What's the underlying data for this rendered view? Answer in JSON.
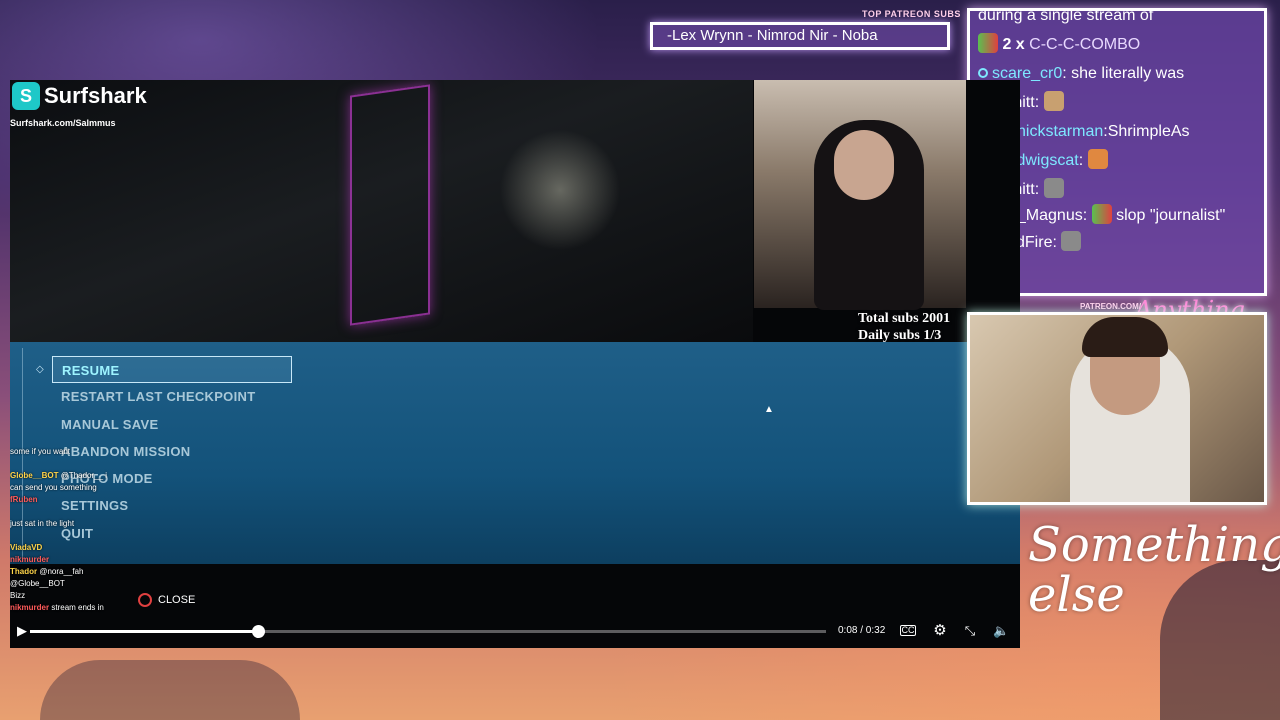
{
  "patreon": {
    "label": "TOP PATREON SUBS",
    "names": "-Lex Wrynn - Nimrod Nir - Noba",
    "url_fragment": "PATREON.COM/"
  },
  "brand": {
    "title_script": "Something else",
    "small_script": "Anything else"
  },
  "chat": {
    "cut_line": "during a single stream of",
    "combo": {
      "count": "2 x",
      "text": "C-C-C-COMBO"
    },
    "messages": [
      {
        "user": "scare_cr0",
        "sep": ":",
        "text": "she literally was"
      },
      {
        "user": "Infinitt",
        "sep": ":",
        "text": ""
      },
      {
        "user": "nickstarman",
        "sep": ":",
        "text": "ShrimpleAs"
      },
      {
        "user": "ludwigscat",
        "sep": ":",
        "text": ""
      },
      {
        "user": "Infinitt",
        "sep": ":",
        "text": ""
      },
      {
        "user": "just_Magnus",
        "sep": ":",
        "text": "slop \"journalist\""
      },
      {
        "user": "ColdFire",
        "sep": ":",
        "text": ""
      }
    ]
  },
  "sponsor": {
    "name": "Surfshark",
    "url": "Surfshark.com/Salmmus"
  },
  "sub_counter": {
    "total": "Total subs 2001",
    "daily": "Daily subs  1/3"
  },
  "pause_menu": {
    "items": [
      "RESUME",
      "RESTART LAST CHECKPOINT",
      "MANUAL SAVE",
      "ABANDON MISSION",
      "PHOTO MODE",
      "SETTINGS",
      "QUIT"
    ],
    "selected_index": 0
  },
  "overlay_chat": [
    {
      "user": "",
      "text": "some if you want"
    },
    {
      "user": "",
      "text": ""
    },
    {
      "user": "Globe__BOT",
      "text": "@Thador__ i"
    },
    {
      "user": "",
      "text": "can send you something"
    },
    {
      "user": "fRuben",
      "text": ""
    },
    {
      "user": "",
      "text": ""
    },
    {
      "user": "",
      "text": "just sat in the light"
    },
    {
      "user": "",
      "text": ""
    },
    {
      "user": "ViadaVD",
      "text": ""
    },
    {
      "user": "nikmurder",
      "text": ""
    },
    {
      "user": "Thador",
      "text": "@nora__fah"
    },
    {
      "user": "",
      "text": "@Globe__BOT"
    },
    {
      "user": "",
      "text": "Bizz"
    },
    {
      "user": "nikmurder",
      "text": "stream ends in"
    }
  ],
  "player": {
    "close_label": "CLOSE",
    "time": "0:08 / 0:32",
    "progress_fraction": 0.287
  },
  "colors": {
    "accent": "#7ee8ff",
    "pause_bg": "#13527a",
    "selected": "#9ef4ff"
  }
}
